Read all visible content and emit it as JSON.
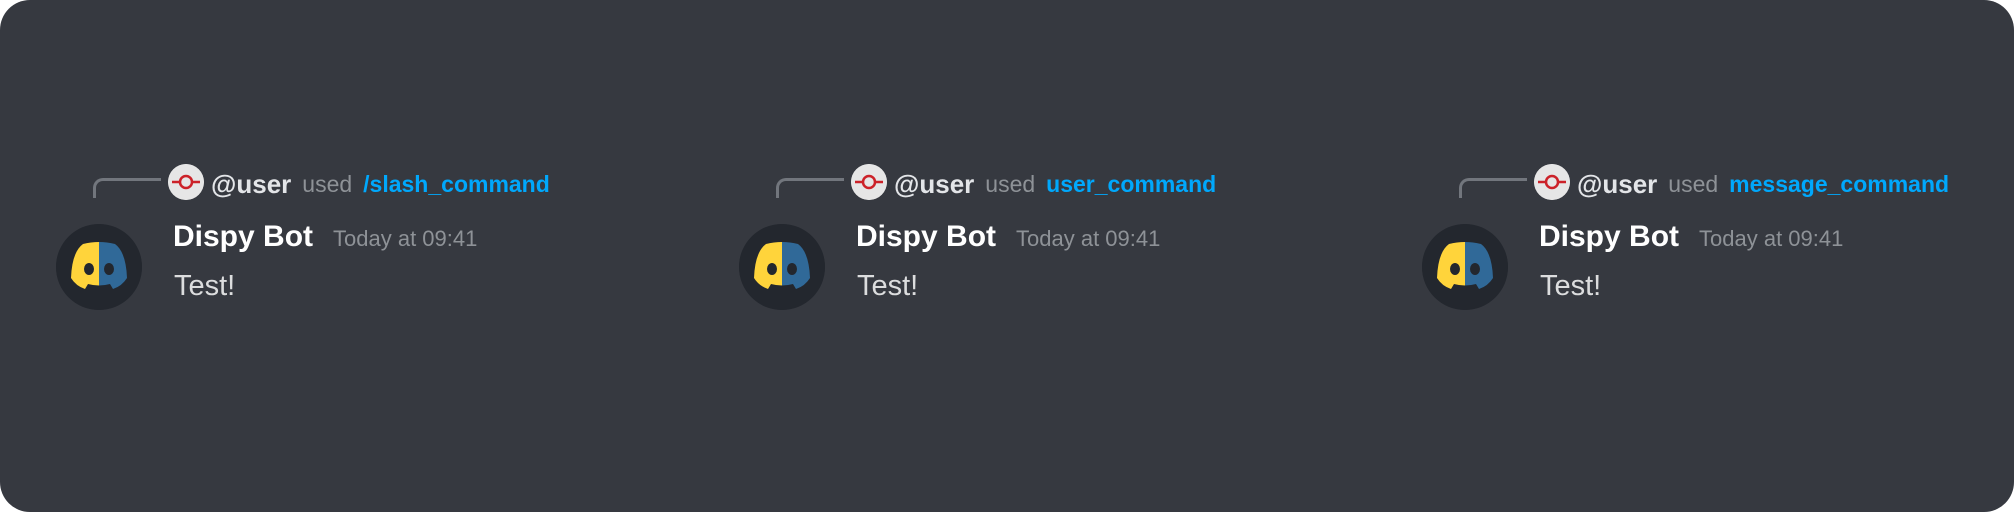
{
  "colors": {
    "background": "#363940",
    "username": "#ffffff",
    "muted": "#8e9297",
    "command_link": "#00a8fc",
    "message_text": "#dcddde",
    "logo_yellow": "#ffd43b",
    "logo_blue": "#306998"
  },
  "messages": [
    {
      "reply": {
        "user": "@user",
        "used": "used",
        "command": "/slash_command"
      },
      "author": "Dispy Bot",
      "timestamp": "Today at 09:41",
      "content": "Test!"
    },
    {
      "reply": {
        "user": "@user",
        "used": "used",
        "command": "user_command"
      },
      "author": "Dispy Bot",
      "timestamp": "Today at 09:41",
      "content": "Test!"
    },
    {
      "reply": {
        "user": "@user",
        "used": "used",
        "command": "message_command"
      },
      "author": "Dispy Bot",
      "timestamp": "Today at 09:41",
      "content": "Test!"
    }
  ]
}
